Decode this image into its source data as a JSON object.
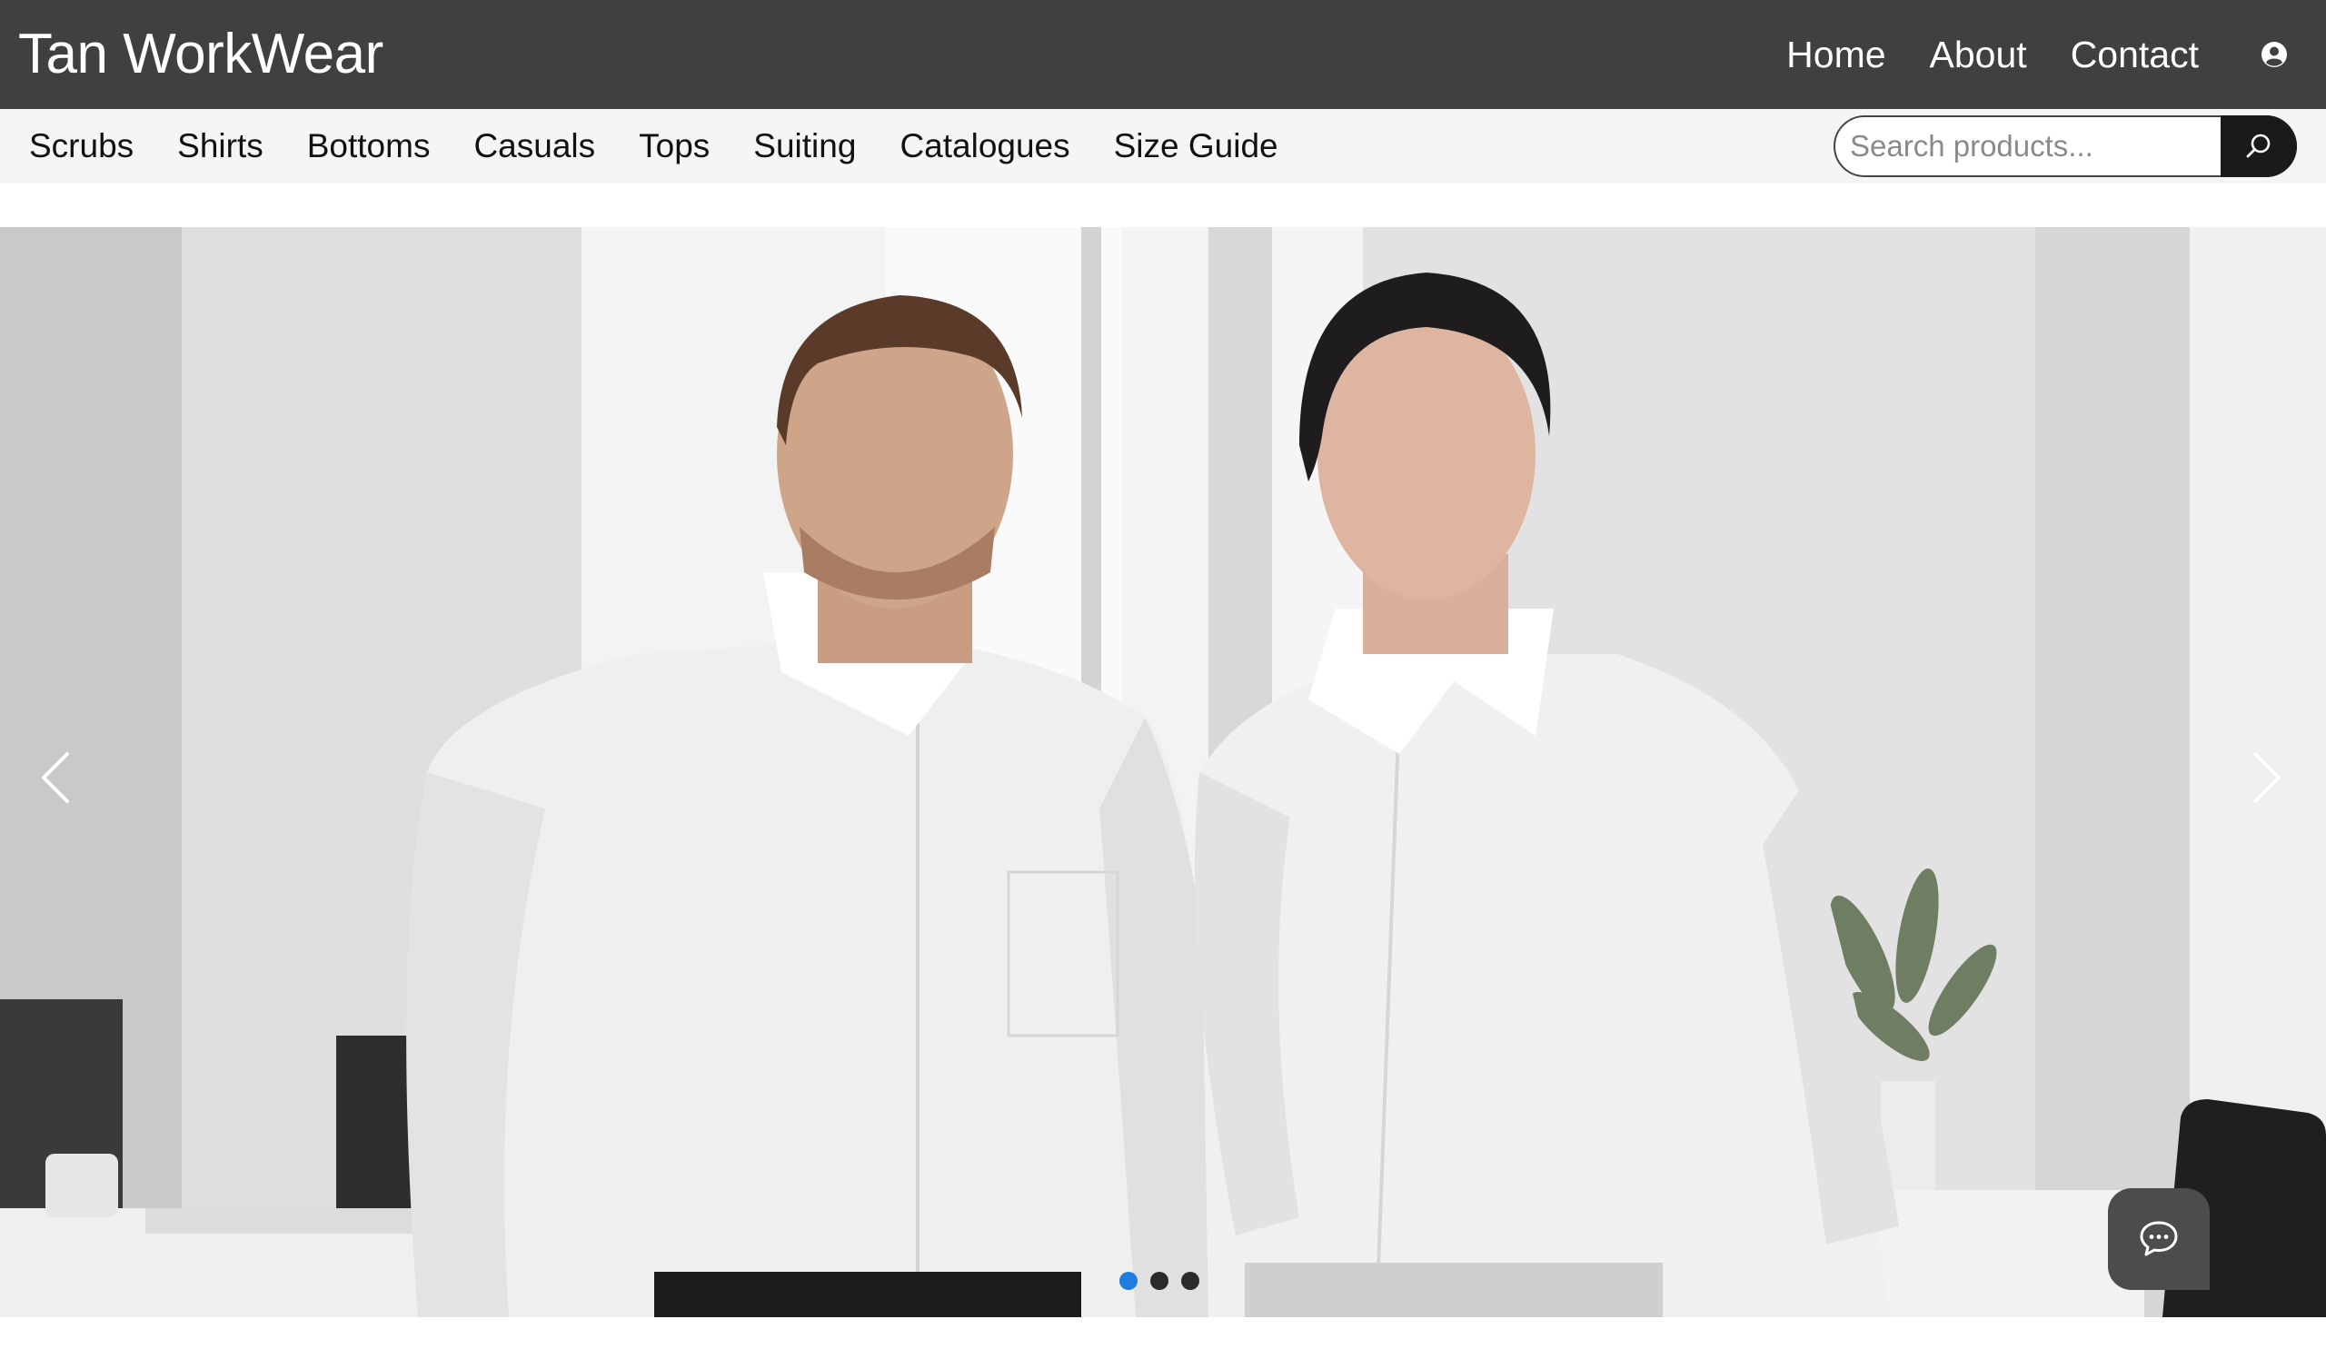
{
  "header": {
    "brand": "Tan WorkWear",
    "nav": [
      {
        "label": "Home"
      },
      {
        "label": "About"
      },
      {
        "label": "Contact"
      }
    ],
    "user_icon": "user-circle-icon"
  },
  "categories": [
    {
      "label": "Scrubs"
    },
    {
      "label": "Shirts"
    },
    {
      "label": "Bottoms"
    },
    {
      "label": "Casuals"
    },
    {
      "label": "Tops"
    },
    {
      "label": "Suiting"
    },
    {
      "label": "Catalogues"
    },
    {
      "label": "Size Guide"
    }
  ],
  "search": {
    "placeholder": "Search products...",
    "value": "",
    "icon": "search-icon"
  },
  "hero": {
    "slide_count": 3,
    "active_slide": 1,
    "prev_icon": "chevron-left-icon",
    "next_icon": "chevron-right-icon"
  },
  "chat": {
    "icon": "chat-bubble-icon"
  },
  "colors": {
    "header_bg": "#404042",
    "category_bar_bg": "#f5f5f5",
    "active_dot": "#1f7de0",
    "search_button": "#1a1a1a"
  }
}
